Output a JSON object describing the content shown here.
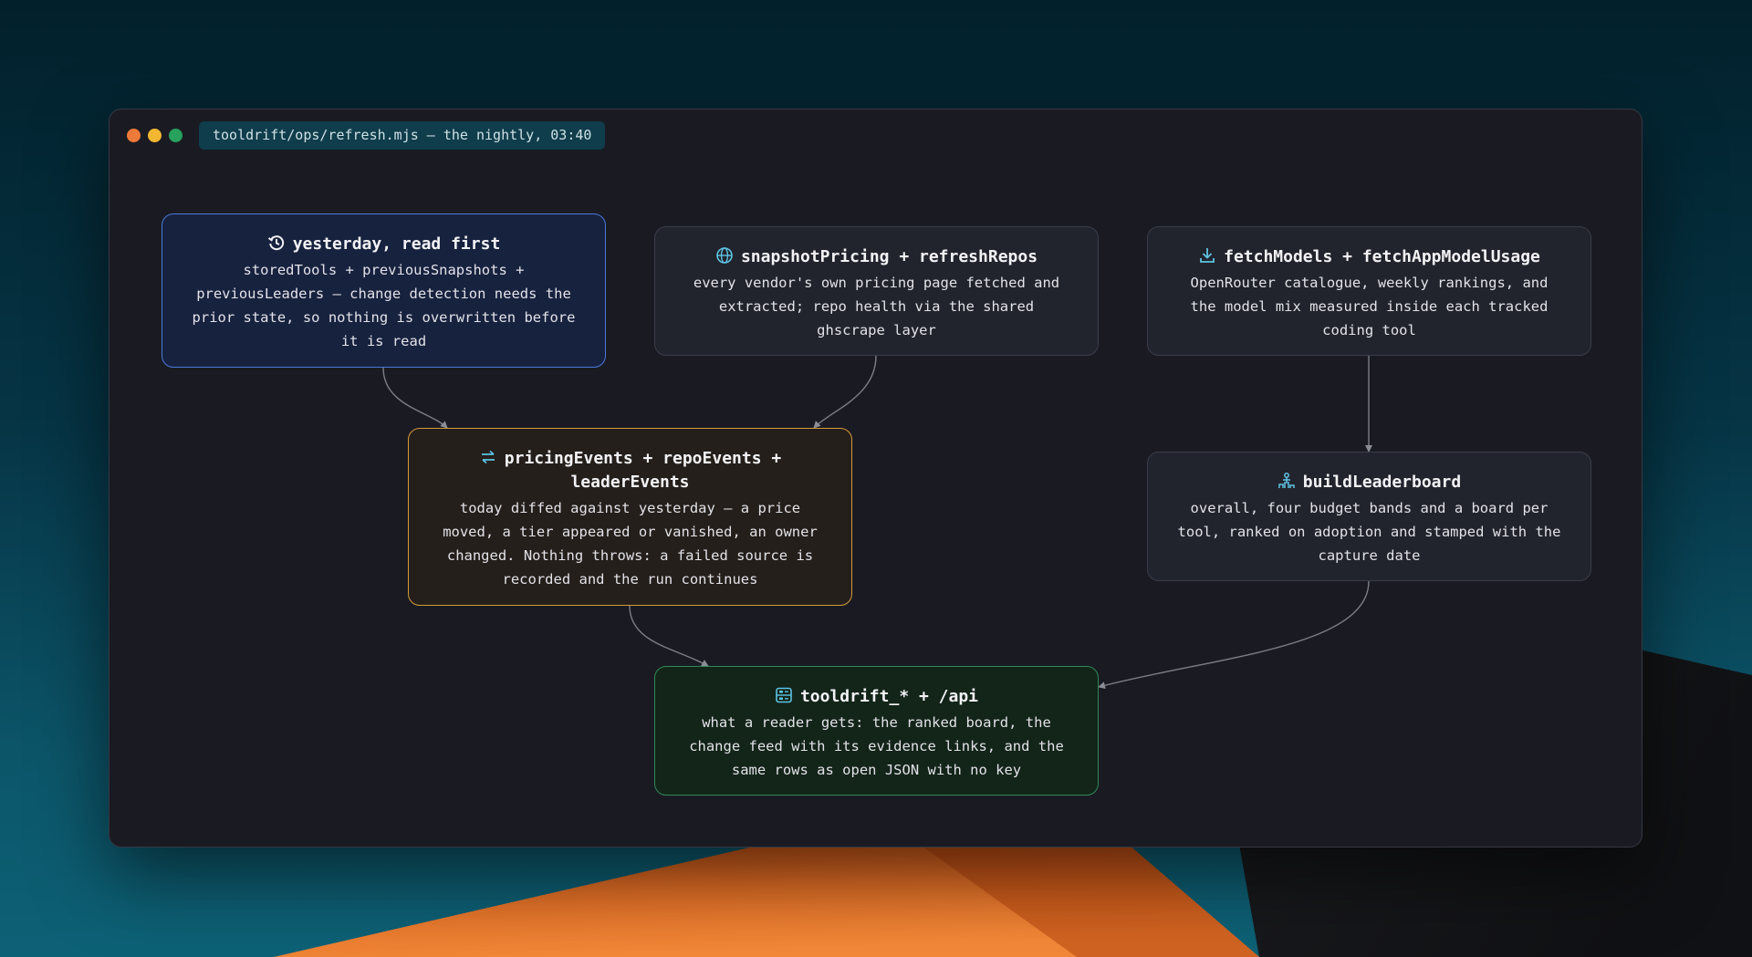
{
  "window": {
    "title": "tooldrift/ops/refresh.mjs — the nightly, 03:40"
  },
  "nodes": {
    "yesterday": {
      "title": "yesterday, read first",
      "icon": "history-icon",
      "description": "storedTools + previousSnapshots + previousLeaders — change detection needs the prior state, so nothing is overwritten before it is read",
      "accent": "#4a79d8"
    },
    "snapshot": {
      "title": "snapshotPricing + refreshRepos",
      "icon": "globe-icon",
      "description": "every vendor's own pricing page fetched and extracted; repo health via the shared ghscrape layer"
    },
    "fetch": {
      "title": "fetchModels + fetchAppModelUsage",
      "icon": "download-icon",
      "description": "OpenRouter catalogue, weekly rankings, and the model mix measured inside each tracked coding tool"
    },
    "events": {
      "title": "pricingEvents + repoEvents + leaderEvents",
      "icon": "swap-arrows-icon",
      "description": "today diffed against yesterday — a price moved, a tier appeared or vanished, an owner changed. Nothing throws: a failed source is recorded and the run continues",
      "accent": "#d49a3c"
    },
    "leader": {
      "title": "buildLeaderboard",
      "icon": "podium-icon",
      "description": "overall, four budget bands and a board per tool, ranked on adoption and stamped with the capture date"
    },
    "output": {
      "title": "tooldrift_* + /api",
      "icon": "server-icon",
      "description": "what a reader gets: the ranked board, the change feed with its evidence links, and the same rows as open JSON with no key",
      "accent": "#2f8a57"
    }
  },
  "edges": [
    {
      "from": "yesterday",
      "to": "events"
    },
    {
      "from": "snapshot",
      "to": "events"
    },
    {
      "from": "fetch",
      "to": "leader"
    },
    {
      "from": "events",
      "to": "output"
    },
    {
      "from": "leader",
      "to": "output"
    }
  ]
}
